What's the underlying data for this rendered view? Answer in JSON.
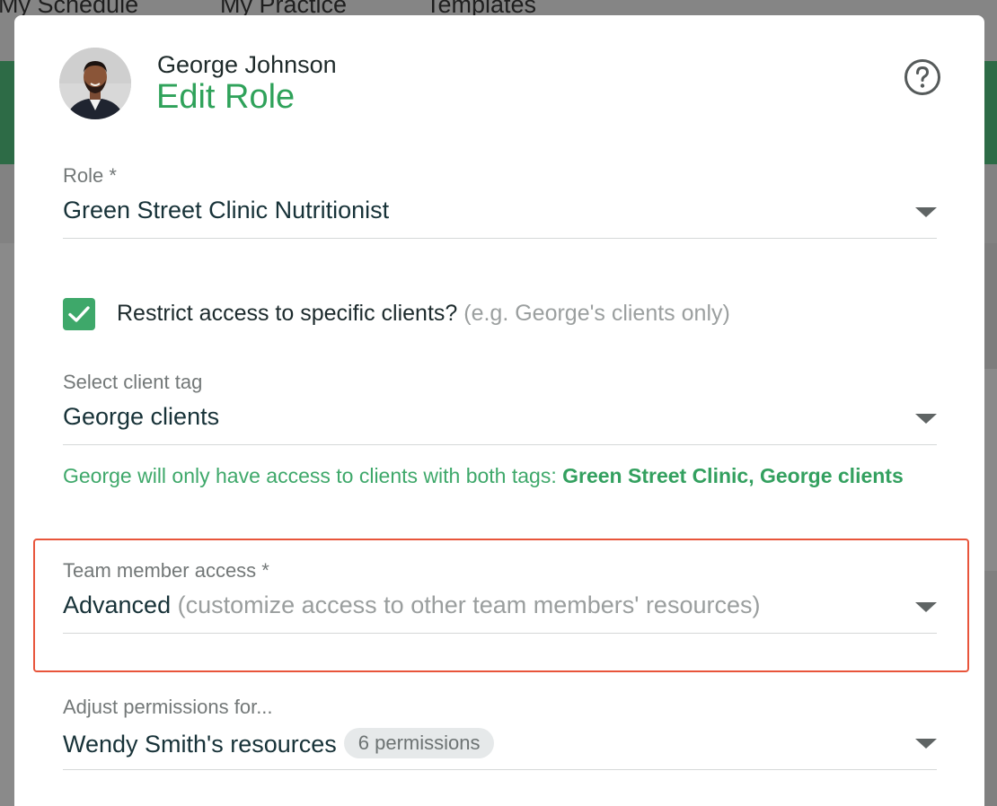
{
  "background": {
    "tabs": [
      "My Schedule",
      "My Practice",
      "Templates"
    ]
  },
  "modal": {
    "user_name": "George Johnson",
    "title": "Edit Role",
    "help_icon": "help-circle-icon",
    "role_field": {
      "label": "Role *",
      "value": "Green Street Clinic Nutritionist"
    },
    "restrict_checkbox": {
      "checked": true,
      "label": "Restrict access to specific clients?",
      "hint": "(e.g. George's clients only)"
    },
    "client_tag_field": {
      "label": "Select client tag",
      "value": "George clients"
    },
    "client_tag_info": {
      "text": "George will only have access to clients with both tags: ",
      "tags": "Green Street Clinic, George clients"
    },
    "team_access_field": {
      "label": "Team member access *",
      "value": "Advanced",
      "hint": "(customize access to other team members' resources)"
    },
    "permissions_field": {
      "label": "Adjust permissions for...",
      "value": "Wendy Smith's resources",
      "badge": "6 permissions"
    }
  },
  "colors": {
    "accent_green": "#2fa25a",
    "checkbox_green": "#3ea86a",
    "highlight_red": "#e8553b"
  }
}
